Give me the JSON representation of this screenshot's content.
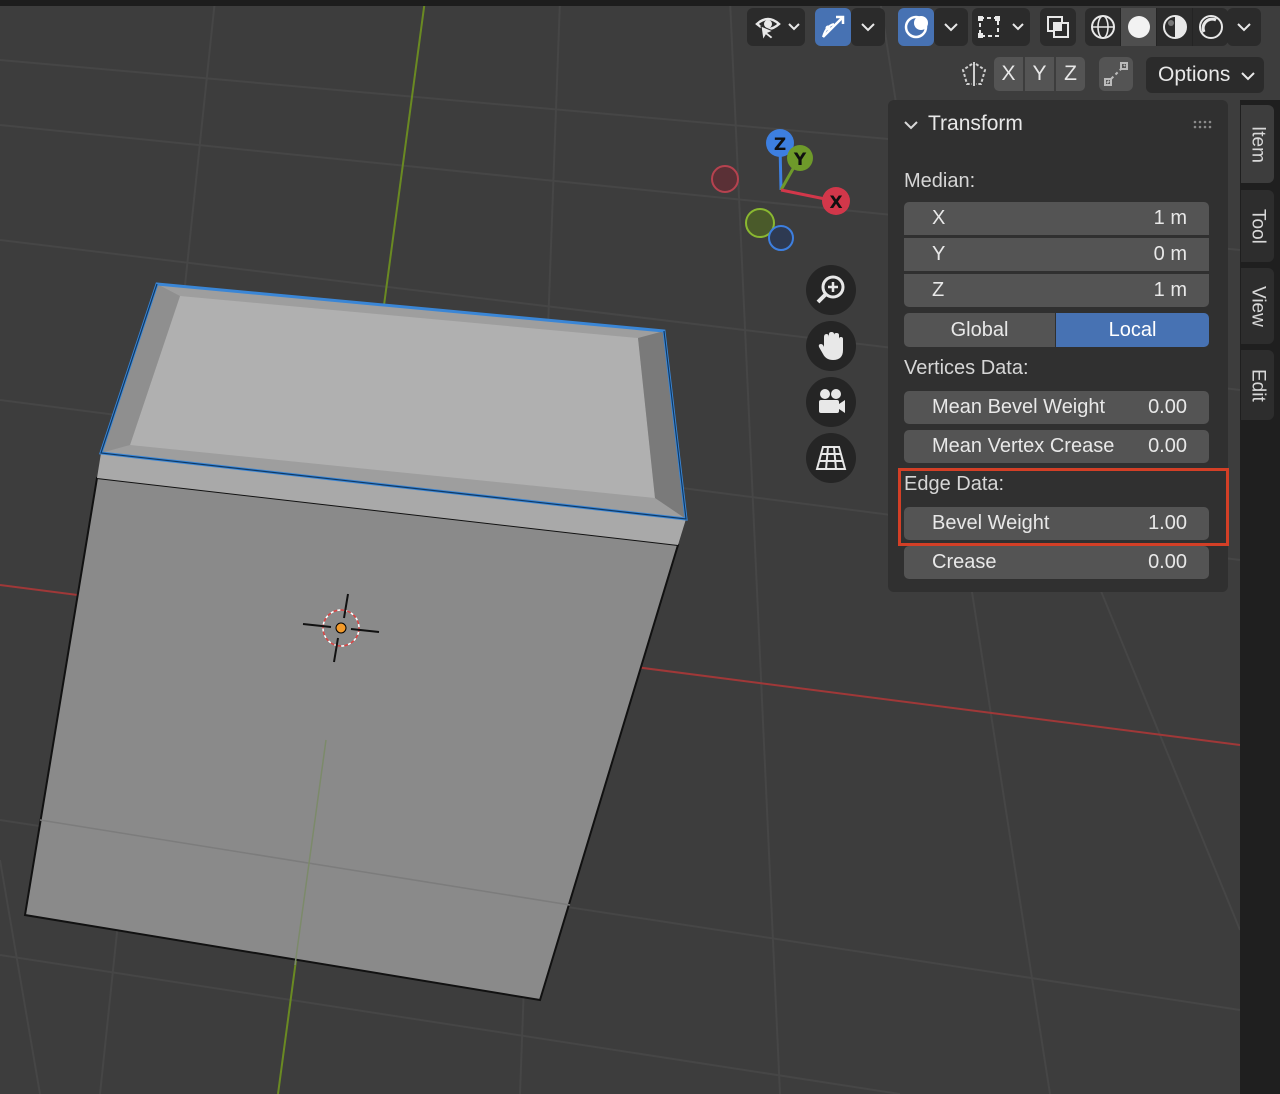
{
  "header": {
    "options_label": "Options",
    "axis_lock": [
      "X",
      "Y",
      "Z"
    ]
  },
  "gizmo": {
    "z": "Z",
    "y": "Y",
    "x": "X"
  },
  "panel": {
    "title": "Transform",
    "median_label": "Median:",
    "median": [
      {
        "name": "X",
        "value": "1 m"
      },
      {
        "name": "Y",
        "value": "0 m"
      },
      {
        "name": "Z",
        "value": "1 m"
      }
    ],
    "space": {
      "global": "Global",
      "local": "Local",
      "selected": "Local"
    },
    "vertices_label": "Vertices Data:",
    "vertices": [
      {
        "name": "Mean Bevel Weight",
        "value": "0.00"
      },
      {
        "name": "Mean Vertex Crease",
        "value": "0.00"
      }
    ],
    "edge_label": "Edge Data:",
    "edge": [
      {
        "name": "Bevel Weight",
        "value": "1.00"
      },
      {
        "name": "Crease",
        "value": "0.00"
      }
    ]
  },
  "tabs": [
    "Item",
    "Tool",
    "View",
    "Edit"
  ],
  "colors": {
    "accent": "#4772b3",
    "highlight": "#d33f26",
    "x_axis": "#d2374a",
    "y_axis": "#6e9a2a",
    "z_axis": "#3d7fe0"
  }
}
